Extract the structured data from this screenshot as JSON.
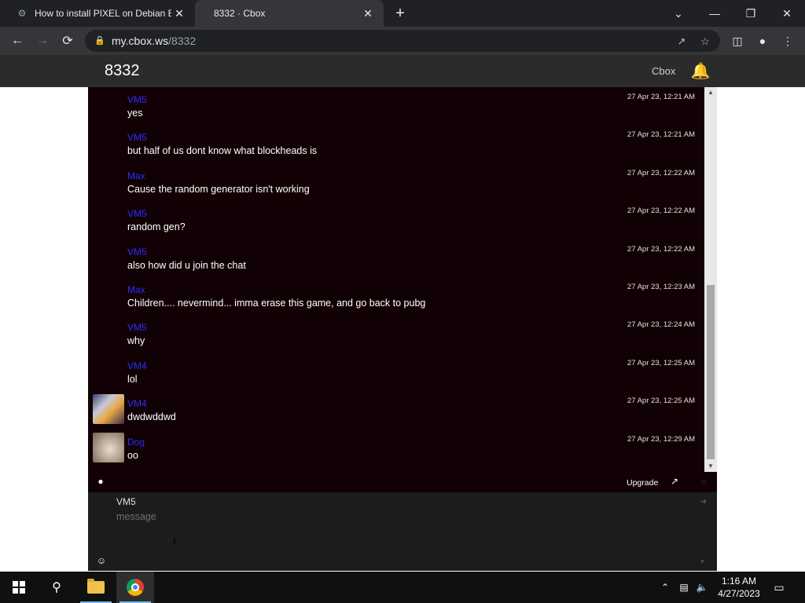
{
  "browser": {
    "tabs": [
      {
        "title": "How to install PIXEL on Debian B",
        "icon": "pixel-favicon"
      },
      {
        "title": "8332 · Cbox",
        "icon": "cbox-favicon"
      }
    ],
    "url_host": "my.cbox.ws",
    "url_path": "/8332"
  },
  "header": {
    "box_name": "8332",
    "brand": "Cbox"
  },
  "messages": [
    {
      "author": "VM5",
      "time": "27 Apr 23, 12:21 AM",
      "text": "yes",
      "color": "#2d2dff"
    },
    {
      "author": "VM5",
      "time": "27 Apr 23, 12:21 AM",
      "text": "but half of us dont know what blockheads is",
      "color": "#2d2dff"
    },
    {
      "author": "Max",
      "time": "27 Apr 23, 12:22 AM",
      "text": "Cause the random generator isn't working",
      "color": "#2d2dff"
    },
    {
      "author": "VM5",
      "time": "27 Apr 23, 12:22 AM",
      "text": "random gen?",
      "color": "#2d2dff"
    },
    {
      "author": "VM5",
      "time": "27 Apr 23, 12:22 AM",
      "text": "also how did u join the chat",
      "color": "#2d2dff"
    },
    {
      "author": "Max",
      "time": "27 Apr 23, 12:23 AM",
      "text": "Children.... nevermind... imma erase this game, and go back to pubg",
      "color": "#2d2dff"
    },
    {
      "author": "VM5",
      "time": "27 Apr 23, 12:24 AM",
      "text": "why",
      "color": "#2d2dff"
    },
    {
      "author": "VM4",
      "time": "27 Apr 23, 12:25 AM",
      "text": "lol",
      "color": "#2d2dff"
    },
    {
      "author": "VM4",
      "time": "27 Apr 23, 12:25 AM",
      "text": "dwdwddwd",
      "color": "#2d2dff"
    },
    {
      "author": "Dog",
      "time": "27 Apr 23, 12:29 AM",
      "text": "oo",
      "color": "#2d2dff"
    }
  ],
  "footer": {
    "upgrade_label": "Upgrade"
  },
  "form": {
    "name": "VM5",
    "message_placeholder": "message",
    "message_value": ""
  },
  "taskbar": {
    "time": "1:16 AM",
    "date": "4/27/2023"
  }
}
